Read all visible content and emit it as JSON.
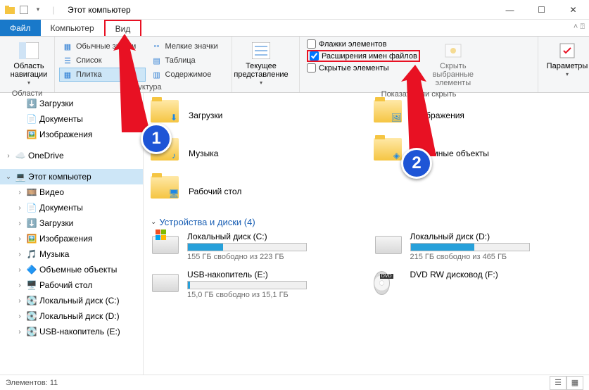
{
  "window": {
    "title": "Этот компьютер",
    "min": "—",
    "max": "☐",
    "close": "✕"
  },
  "tabs": {
    "file": "Файл",
    "computer": "Компьютер",
    "view": "Вид"
  },
  "ribbon": {
    "nav_pane": "Область навигации",
    "nav_group": "Области",
    "layout": {
      "extra_large": "Обычные значки",
      "small": "Мелкие значки",
      "list": "Список",
      "table": "Таблица",
      "tiles": "Плитка",
      "content": "Содержимое",
      "group": "Структура"
    },
    "current_view": "Текущее представление",
    "checks": {
      "item_flags": "Флажки элементов",
      "extensions": "Расширения имен файлов",
      "hidden": "Скрытые элементы"
    },
    "hide_selected": "Скрыть выбранные элементы",
    "show_hide_group": "Показать или скрыть",
    "options": "Параметры"
  },
  "nav_header": "Области",
  "tree": {
    "downloads": "Загрузки",
    "documents": "Документы",
    "pictures": "Изображения",
    "onedrive": "OneDrive",
    "this_pc": "Этот компьютер",
    "videos": "Видео",
    "documents2": "Документы",
    "downloads2": "Загрузки",
    "pictures2": "Изображения",
    "music": "Музыка",
    "objects3d": "Объемные объекты",
    "desktop": "Рабочий стол",
    "local_c": "Локальный диск (C:)",
    "local_d": "Локальный диск (D:)",
    "usb_e": "USB-накопитель (E:)"
  },
  "folders": {
    "downloads": "Загрузки",
    "pictures": "Изображения",
    "music": "Музыка",
    "objects3d": "Объемные объекты",
    "desktop": "Рабочий стол"
  },
  "section": {
    "devices": "Устройства и диски (4)"
  },
  "drives": {
    "c": {
      "name": "Локальный диск (C:)",
      "sub": "155 ГБ свободно из 223 ГБ",
      "fill": 30
    },
    "d": {
      "name": "Локальный диск (D:)",
      "sub": "215 ГБ свободно из 465 ГБ",
      "fill": 54
    },
    "e": {
      "name": "USB-накопитель (E:)",
      "sub": "15,0 ГБ свободно из 15,1 ГБ",
      "fill": 2
    },
    "f": {
      "name": "DVD RW дисковод (F:)",
      "sub": ""
    }
  },
  "status": {
    "elements": "Элементов: 11"
  },
  "annotations": {
    "one": "1",
    "two": "2"
  }
}
